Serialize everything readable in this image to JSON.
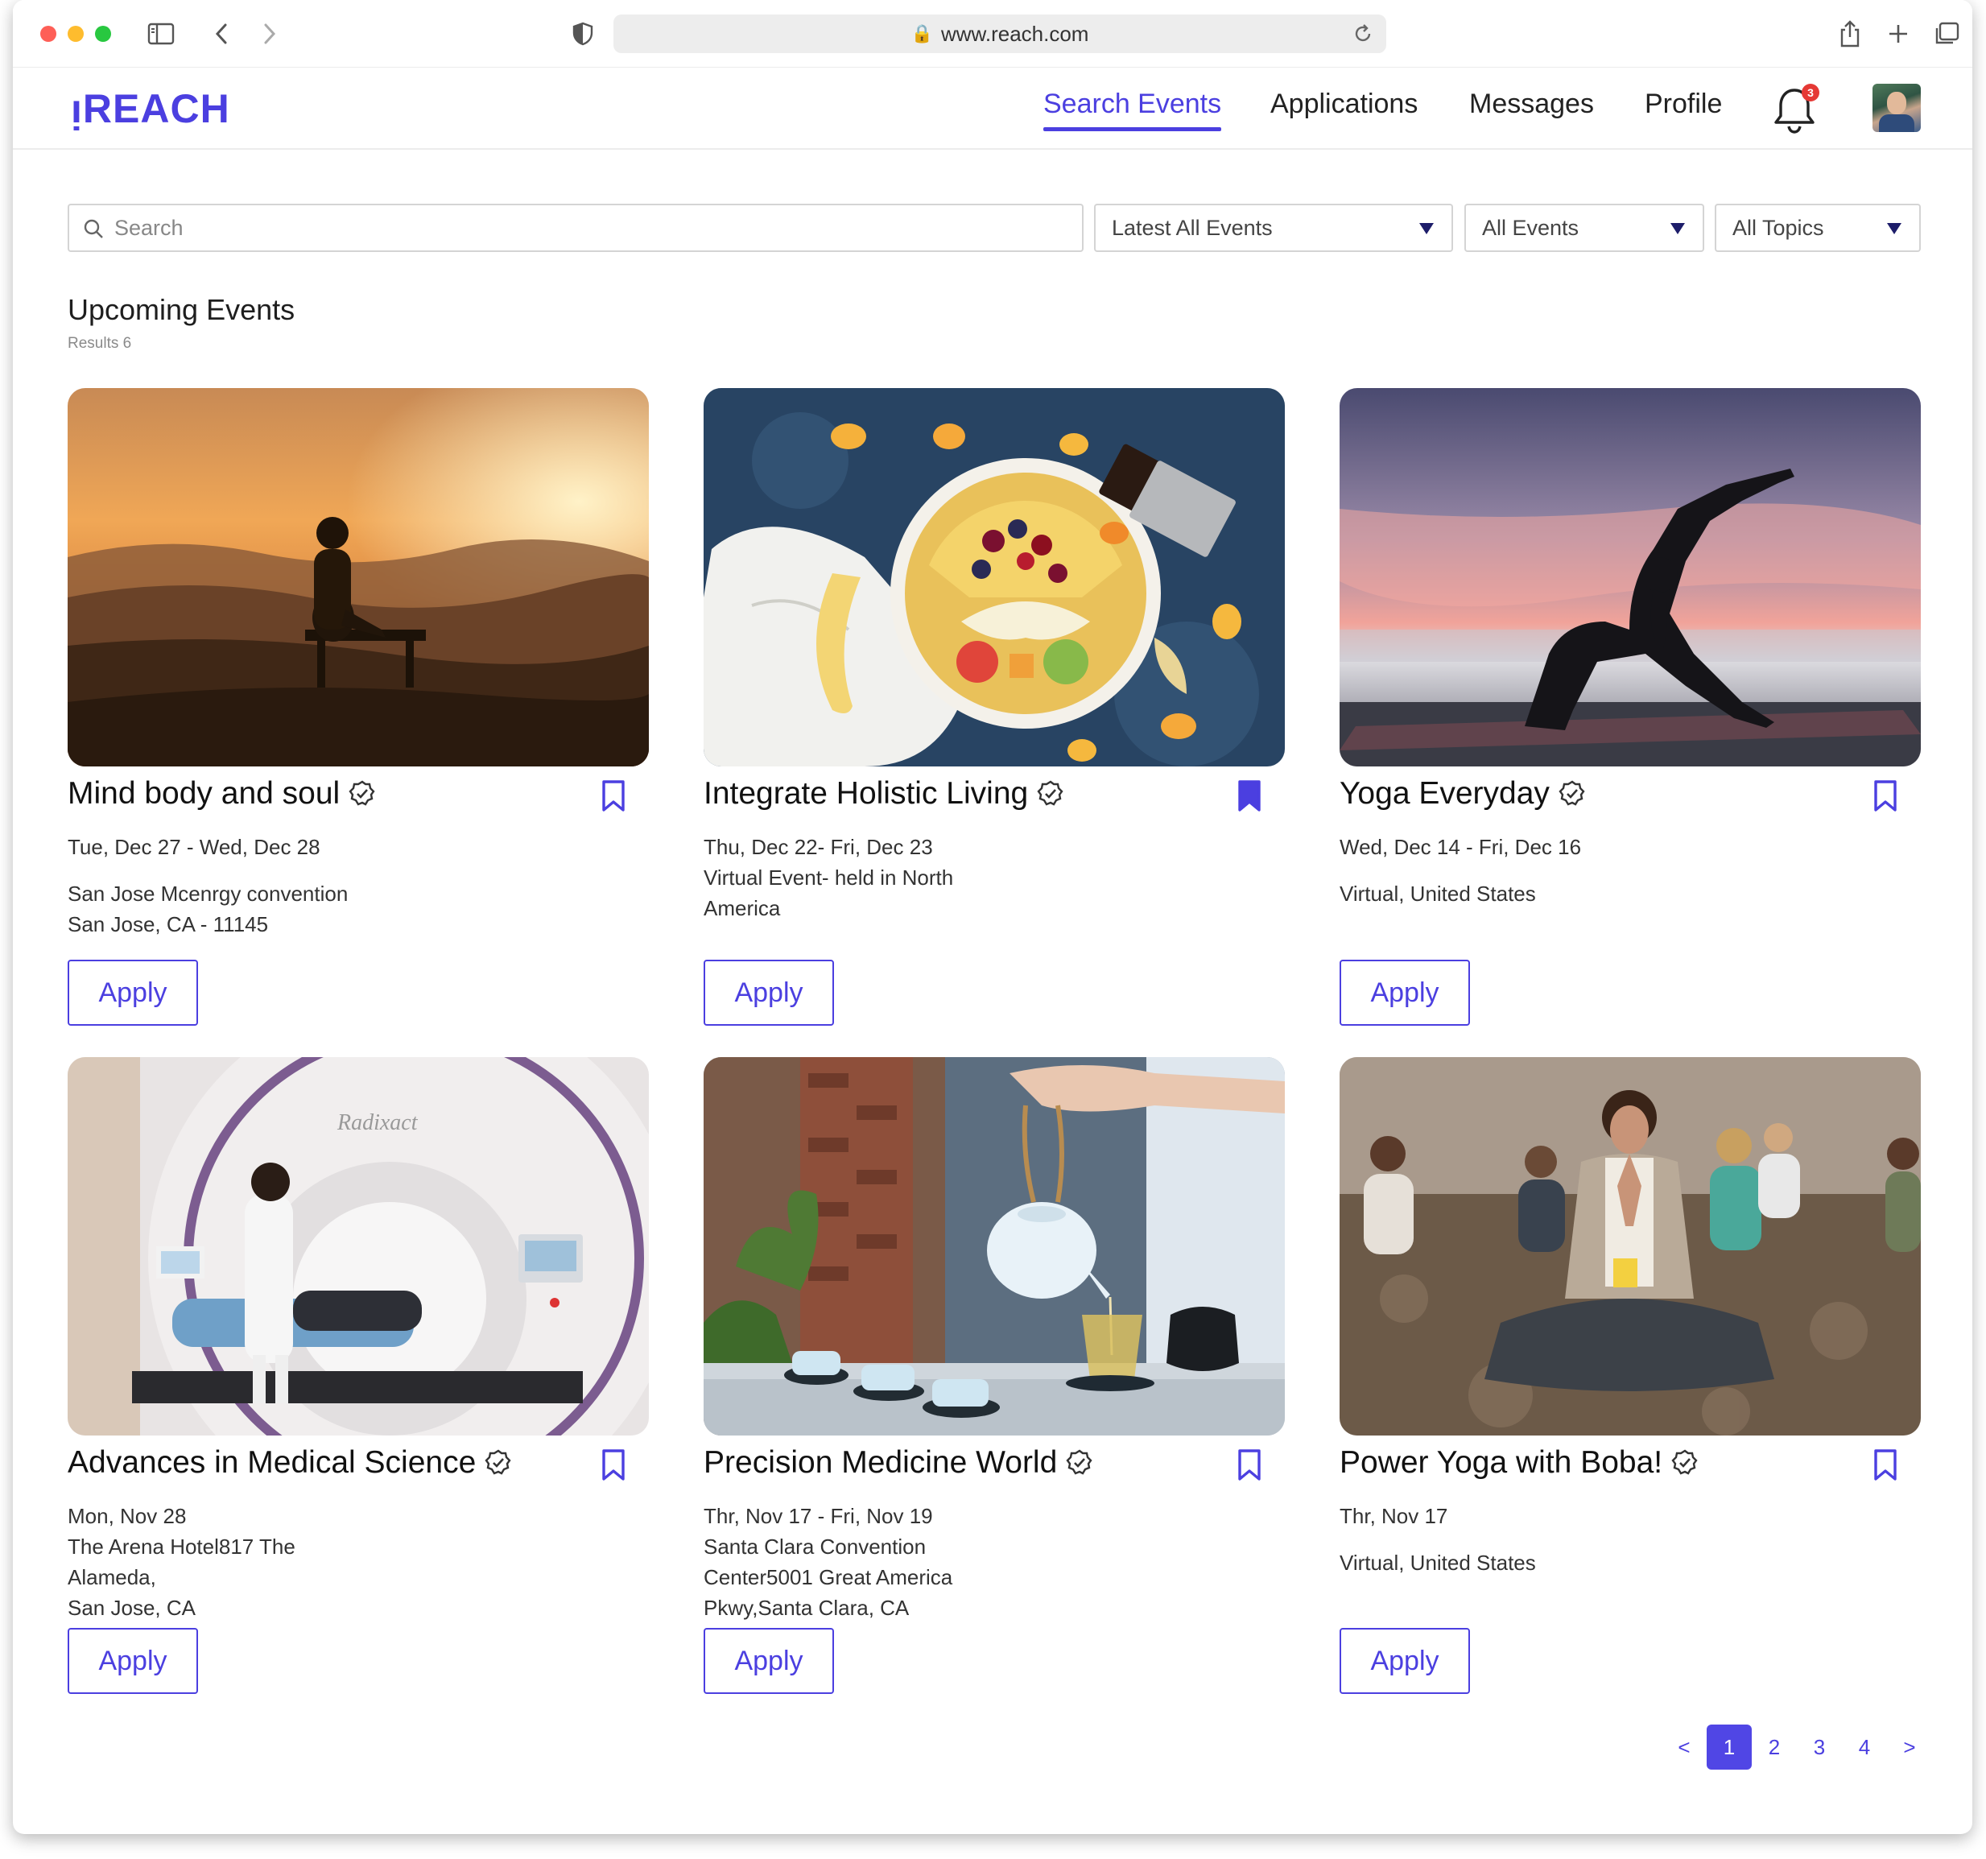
{
  "browser": {
    "url": "www.reach.com"
  },
  "app": {
    "logo": "ᴉREACH",
    "nav": [
      "Search  Events",
      "Applications",
      "Messages",
      "Profile"
    ],
    "notification_count": "3"
  },
  "filters": {
    "search_placeholder": "Search",
    "sort": "Latest All Events",
    "type": "All Events",
    "topic": "All Topics"
  },
  "section": {
    "title": "Upcoming Events",
    "results": "Results 6"
  },
  "events": [
    {
      "title": "Mind body and soul",
      "bookmarked": false,
      "lines": [
        "Tue, Dec 27 - Wed, Dec 28",
        "",
        "San Jose Mcenrgy convention",
        "San Jose, CA - 11145"
      ],
      "apply": "Apply"
    },
    {
      "title": "Integrate Holistic Living",
      "bookmarked": true,
      "lines": [
        "Thu, Dec 22- Fri, Dec 23",
        "Virtual Event- held in North",
        "America"
      ],
      "apply": "Apply"
    },
    {
      "title": "Yoga Everyday",
      "bookmarked": false,
      "lines": [
        "Wed, Dec 14 - Fri, Dec 16",
        "",
        "Virtual, United States"
      ],
      "apply": "Apply"
    },
    {
      "title": "Advances in Medical Science",
      "bookmarked": false,
      "lines": [
        "Mon, Nov 28",
        "The Arena Hotel817 The",
        "Alameda,",
        "San Jose, CA"
      ],
      "apply": "Apply"
    },
    {
      "title": "Precision Medicine World",
      "bookmarked": false,
      "lines": [
        "Thr, Nov 17 - Fri, Nov 19",
        "Santa Clara Convention",
        "Center5001 Great America",
        "Pkwy,Santa Clara, CA"
      ],
      "apply": "Apply"
    },
    {
      "title": "Power Yoga with Boba!",
      "bookmarked": false,
      "lines": [
        "Thr, Nov 17",
        "",
        "Virtual, United States"
      ],
      "apply": "Apply"
    }
  ],
  "image_text": {
    "scanner_brand": "Radixact"
  },
  "pagination": {
    "prev": "<",
    "pages": [
      "1",
      "2",
      "3",
      "4"
    ],
    "next": ">",
    "current": "1"
  },
  "colors": {
    "accent": "#4b3fe0",
    "badge": "#e53935"
  }
}
